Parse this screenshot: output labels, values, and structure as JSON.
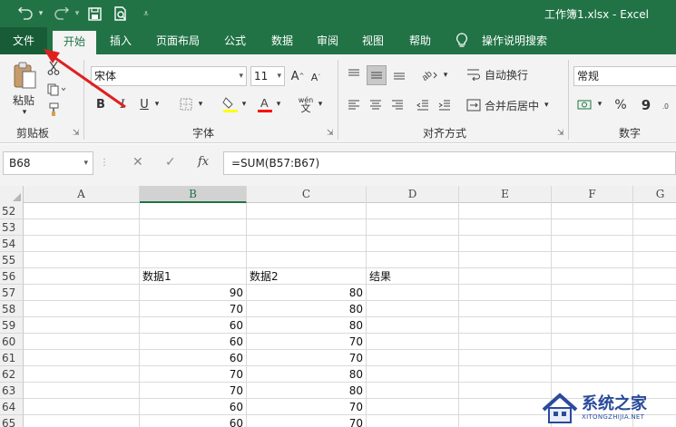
{
  "titlebar": {
    "title": "工作簿1.xlsx  -  Excel",
    "icons": [
      "undo-icon",
      "redo-icon",
      "save-icon",
      "print-preview-icon",
      "customize-qat-icon"
    ]
  },
  "tabs": [
    "文件",
    "开始",
    "插入",
    "页面布局",
    "公式",
    "数据",
    "审阅",
    "视图",
    "帮助",
    "操作说明搜索"
  ],
  "active_tab": "开始",
  "ribbon": {
    "clipboard": {
      "paste_label": "粘贴",
      "group_label": "剪贴板"
    },
    "font": {
      "font_name": "宋体",
      "font_size": "11",
      "group_label": "字体",
      "bold": "B",
      "italic": "I",
      "underline": "U",
      "grow": "A",
      "shrink": "A",
      "phonetic": "wén"
    },
    "alignment": {
      "wrap_text": "自动换行",
      "merge_center": "合并后居中",
      "group_label": "对齐方式"
    },
    "number": {
      "format": "常规",
      "percent": "%",
      "comma": "9",
      "group_label": "数字"
    },
    "colors": {
      "fill": "#ffff00",
      "font": "#ff0000"
    }
  },
  "formulabar": {
    "namebox": "B68",
    "fx_label": "fx",
    "formula": "=SUM(B57:B67)"
  },
  "grid": {
    "columns": [
      "A",
      "B",
      "C",
      "D",
      "E",
      "F",
      "G"
    ],
    "selected_column": "B",
    "rows": [
      {
        "num": "52",
        "cells": [
          "",
          "",
          "",
          ""
        ]
      },
      {
        "num": "53",
        "cells": [
          "",
          "",
          "",
          ""
        ]
      },
      {
        "num": "54",
        "cells": [
          "",
          "",
          "",
          ""
        ]
      },
      {
        "num": "55",
        "cells": [
          "",
          "",
          "",
          ""
        ]
      },
      {
        "num": "56",
        "cells": [
          "",
          "数据1",
          "数据2",
          "结果"
        ]
      },
      {
        "num": "57",
        "cells": [
          "",
          "90",
          "80",
          ""
        ]
      },
      {
        "num": "58",
        "cells": [
          "",
          "70",
          "80",
          ""
        ]
      },
      {
        "num": "59",
        "cells": [
          "",
          "60",
          "80",
          ""
        ]
      },
      {
        "num": "60",
        "cells": [
          "",
          "60",
          "70",
          ""
        ]
      },
      {
        "num": "61",
        "cells": [
          "",
          "60",
          "70",
          ""
        ]
      },
      {
        "num": "62",
        "cells": [
          "",
          "70",
          "80",
          ""
        ]
      },
      {
        "num": "63",
        "cells": [
          "",
          "70",
          "80",
          ""
        ]
      },
      {
        "num": "64",
        "cells": [
          "",
          "60",
          "70",
          ""
        ]
      },
      {
        "num": "65",
        "cells": [
          "",
          "60",
          "70",
          ""
        ]
      }
    ]
  },
  "watermark": {
    "text": "系统之家",
    "sub": "XITONGZHIJIA.NET"
  },
  "accent_color": "#217346"
}
